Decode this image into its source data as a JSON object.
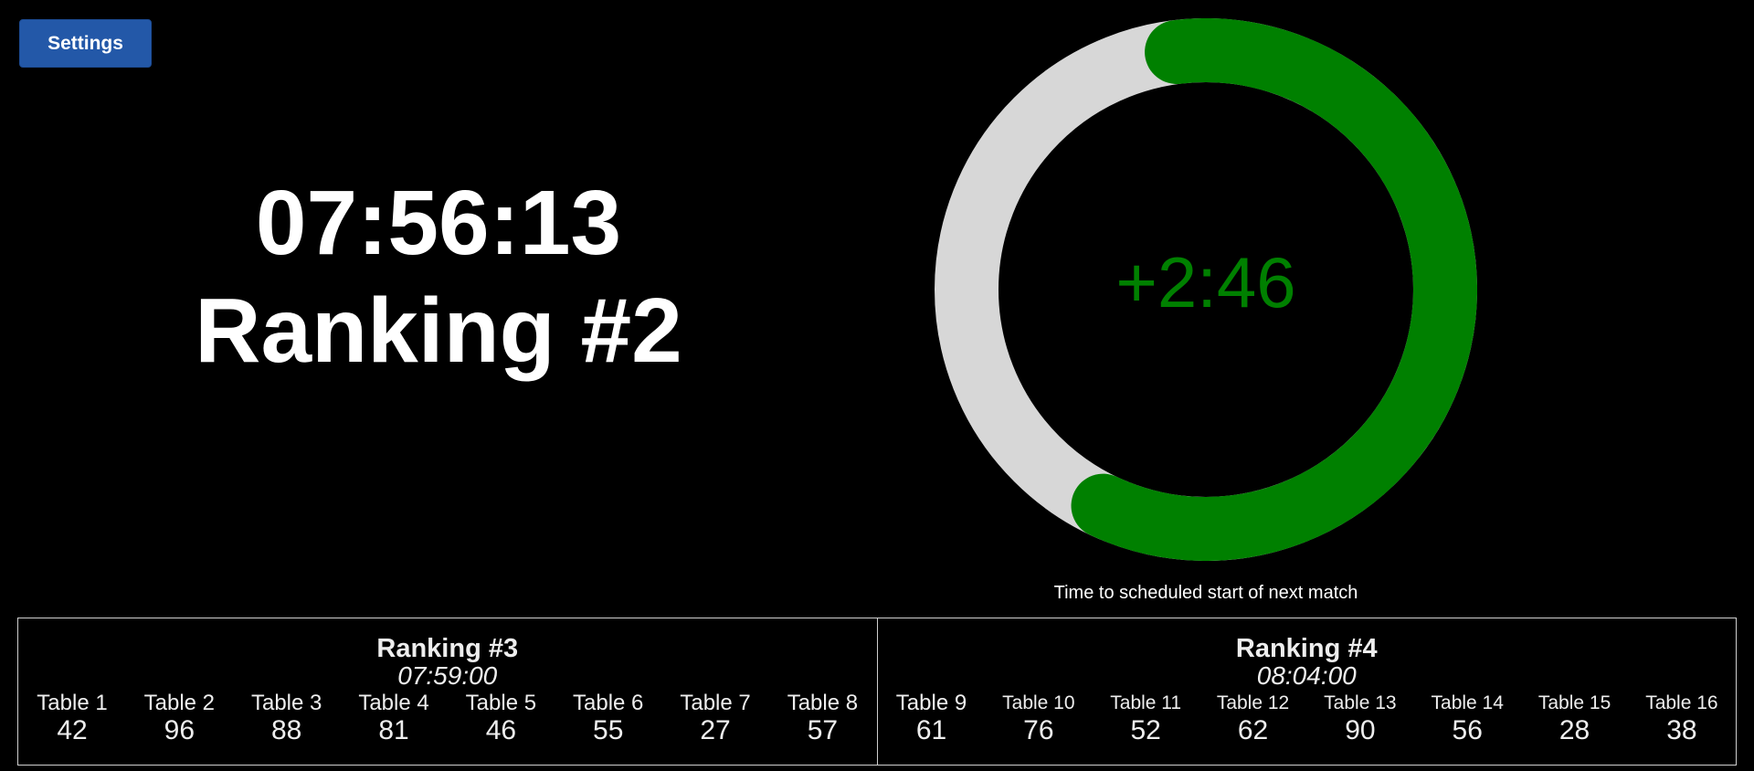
{
  "settings_button": {
    "label": "Settings"
  },
  "current": {
    "time": "07:56:13",
    "ranking": "Ranking #2"
  },
  "countdown": {
    "value": "+2:46",
    "caption": "Time to scheduled start of next match",
    "progress_fraction": 0.59,
    "color": "#008000",
    "track_color": "#d7d7d7"
  },
  "upcoming": [
    {
      "title": "Ranking #3",
      "time": "07:59:00",
      "tables": [
        {
          "name": "Table 1",
          "value": "42"
        },
        {
          "name": "Table 2",
          "value": "96"
        },
        {
          "name": "Table 3",
          "value": "88"
        },
        {
          "name": "Table 4",
          "value": "81"
        },
        {
          "name": "Table 5",
          "value": "46"
        },
        {
          "name": "Table 6",
          "value": "55"
        },
        {
          "name": "Table 7",
          "value": "27"
        },
        {
          "name": "Table 8",
          "value": "57"
        }
      ]
    },
    {
      "title": "Ranking #4",
      "time": "08:04:00",
      "tables": [
        {
          "name": "Table 9",
          "value": "61"
        },
        {
          "name": "Table 10",
          "value": "76"
        },
        {
          "name": "Table 11",
          "value": "52"
        },
        {
          "name": "Table 12",
          "value": "62"
        },
        {
          "name": "Table 13",
          "value": "90"
        },
        {
          "name": "Table 14",
          "value": "56"
        },
        {
          "name": "Table 15",
          "value": "28"
        },
        {
          "name": "Table 16",
          "value": "38"
        }
      ]
    }
  ]
}
